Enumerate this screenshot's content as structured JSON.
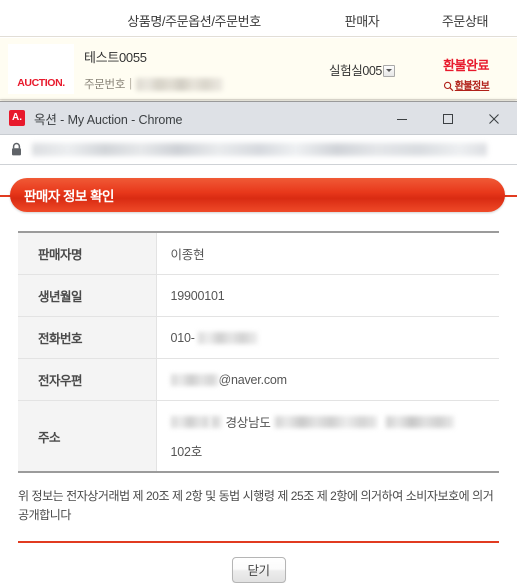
{
  "order_list": {
    "columns": {
      "product": "상품명/주문옵션/주문번호",
      "seller": "판매자",
      "status": "주문상태"
    },
    "row": {
      "thumbnail_logo": "AUCTION.",
      "product_name": "테스트0055",
      "order_no_label": "주문번호",
      "order_no_separator": "|",
      "order_no_value": "",
      "seller_name": "실험실005",
      "seller_select_icon": "chevron-down-icon",
      "status_text": "환불완료",
      "status_link_icon": "magnifier-icon",
      "status_link_text": "환불정보"
    }
  },
  "browser": {
    "favicon_letter": "A.",
    "favicon_color": "#e8192c",
    "window_title": "옥션 - My Auction - Chrome",
    "controls": {
      "minimize": "minimize-icon",
      "maximize": "maximize-icon",
      "close": "close-icon"
    },
    "address_bar": {
      "lock_icon": "lock-icon",
      "url_value": ""
    }
  },
  "popup": {
    "banner_title": "판매자 정보 확인",
    "banner_color": "#e8381b",
    "info_rows": [
      {
        "label": "판매자명",
        "value": "이종현",
        "redacted": false
      },
      {
        "label": "생년월일",
        "value": "19900101",
        "redacted": false
      },
      {
        "label": "전화번호",
        "value": "010-",
        "redacted": true
      },
      {
        "label": "전자우편",
        "value": "@naver.com",
        "redacted": true
      },
      {
        "label": "주소",
        "value_line1": "경상남도",
        "value_line2": "102호",
        "redacted": true
      }
    ],
    "notice": "위 정보는 전자상거래법 제 20조 제 2항 및 동법 시행령 제 25조 제 2항에 의거하여 소비자보호에 의거 공개합니다",
    "close_button": "닫기",
    "rule_color": "#e13b20"
  }
}
